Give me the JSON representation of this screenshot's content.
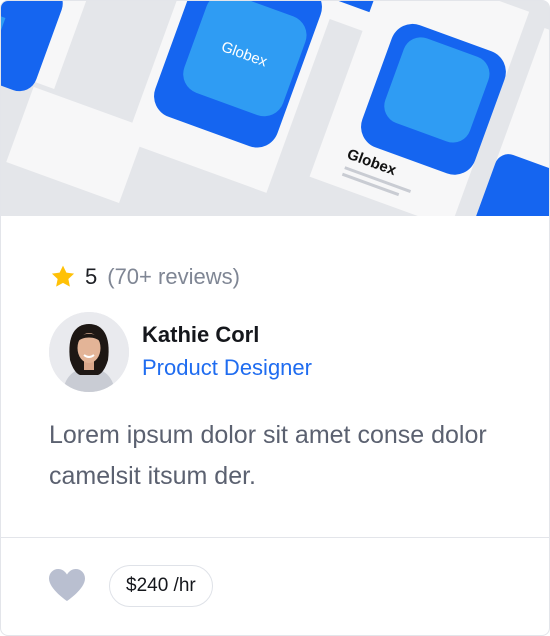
{
  "hero": {
    "brand_text": "Globex",
    "colors": {
      "primary": "#1565f0",
      "light": "#2f9cf3",
      "paper": "#f7f7f8"
    }
  },
  "rating": {
    "icon": "star-icon",
    "value": "5",
    "reviews": "(70+ reviews)"
  },
  "profile": {
    "name": "Kathie Corl",
    "role": "Product Designer"
  },
  "description": "Lorem ipsum dolor sit amet conse dolor camelsit itsum der.",
  "footer": {
    "favorite_icon": "heart-icon",
    "price": "$240 /hr"
  },
  "colors": {
    "accent": "#1f6cf0",
    "star": "#ffc107",
    "heart": "#b9bfd0"
  }
}
